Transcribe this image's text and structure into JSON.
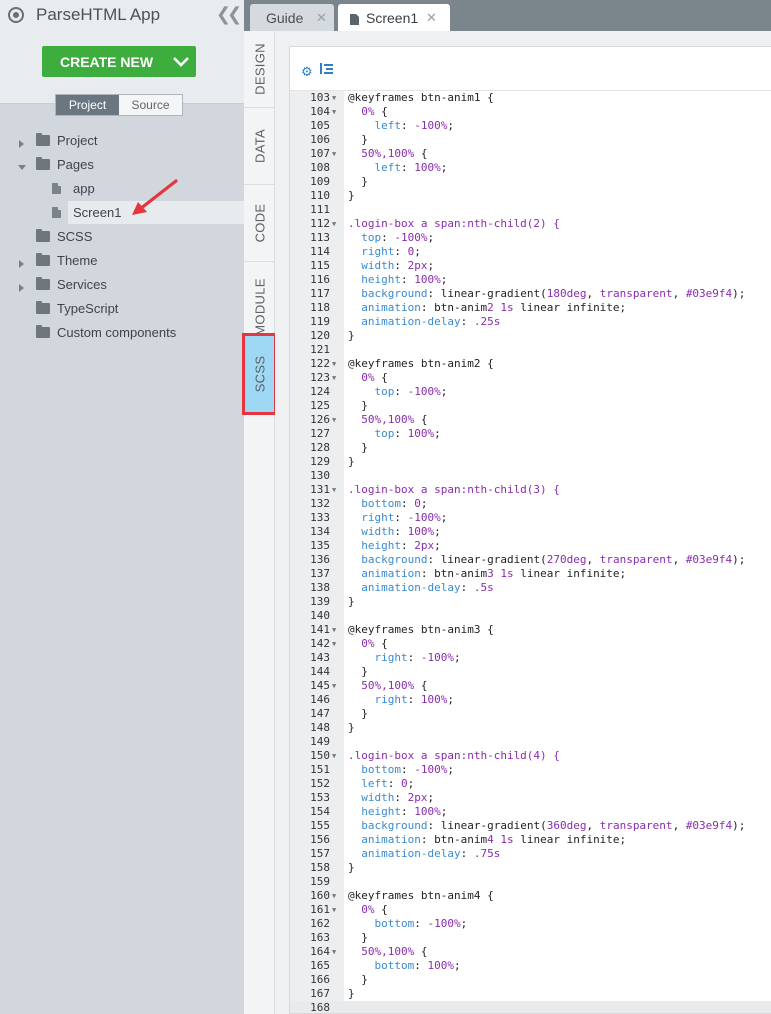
{
  "app": {
    "title": "ParseHTML App",
    "create_label": "CREATE NEW"
  },
  "toggle": {
    "project": "Project",
    "source": "Source"
  },
  "tree": [
    {
      "label": "Project",
      "type": "folder",
      "caret": "right"
    },
    {
      "label": "Pages",
      "type": "folder",
      "caret": "down"
    },
    {
      "label": "app",
      "type": "file"
    },
    {
      "label": "Screen1",
      "type": "file",
      "selected": true
    },
    {
      "label": "SCSS",
      "type": "folder"
    },
    {
      "label": "Theme",
      "type": "folder",
      "caret": "right"
    },
    {
      "label": "Services",
      "type": "folder",
      "caret": "right"
    },
    {
      "label": "TypeScript",
      "type": "folder"
    },
    {
      "label": "Custom components",
      "type": "folder"
    }
  ],
  "vtabs": [
    "DESIGN",
    "DATA",
    "CODE",
    "MODULE",
    "SCSS"
  ],
  "tabs": [
    {
      "label": "Guide"
    },
    {
      "label": "Screen1"
    }
  ],
  "colors": {
    "accent": "#3dae3d",
    "highlight": "#e5363f",
    "active_tab": "#9fd8f5"
  },
  "code_lines": [
    {
      "n": "103",
      "f": true,
      "t": "@keyframes btn-anim1 {"
    },
    {
      "n": "104",
      "f": true,
      "t": "  0% {"
    },
    {
      "n": "105",
      "f": false,
      "t": "    left: -100%;"
    },
    {
      "n": "106",
      "f": false,
      "t": "  }"
    },
    {
      "n": "107",
      "f": true,
      "t": "  50%,100% {"
    },
    {
      "n": "108",
      "f": false,
      "t": "    left: 100%;"
    },
    {
      "n": "109",
      "f": false,
      "t": "  }"
    },
    {
      "n": "110",
      "f": false,
      "t": "}"
    },
    {
      "n": "111",
      "f": false,
      "t": ""
    },
    {
      "n": "112",
      "f": true,
      "t": ".login-box a span:nth-child(2) {"
    },
    {
      "n": "113",
      "f": false,
      "t": "  top: -100%;"
    },
    {
      "n": "114",
      "f": false,
      "t": "  right: 0;"
    },
    {
      "n": "115",
      "f": false,
      "t": "  width: 2px;"
    },
    {
      "n": "116",
      "f": false,
      "t": "  height: 100%;"
    },
    {
      "n": "117",
      "f": false,
      "t": "  background: linear-gradient(180deg, transparent, #03e9f4);"
    },
    {
      "n": "118",
      "f": false,
      "t": "  animation: btn-anim2 1s linear infinite;"
    },
    {
      "n": "119",
      "f": false,
      "t": "  animation-delay: .25s"
    },
    {
      "n": "120",
      "f": false,
      "t": "}"
    },
    {
      "n": "121",
      "f": false,
      "t": ""
    },
    {
      "n": "122",
      "f": true,
      "t": "@keyframes btn-anim2 {"
    },
    {
      "n": "123",
      "f": true,
      "t": "  0% {"
    },
    {
      "n": "124",
      "f": false,
      "t": "    top: -100%;"
    },
    {
      "n": "125",
      "f": false,
      "t": "  }"
    },
    {
      "n": "126",
      "f": true,
      "t": "  50%,100% {"
    },
    {
      "n": "127",
      "f": false,
      "t": "    top: 100%;"
    },
    {
      "n": "128",
      "f": false,
      "t": "  }"
    },
    {
      "n": "129",
      "f": false,
      "t": "}"
    },
    {
      "n": "130",
      "f": false,
      "t": ""
    },
    {
      "n": "131",
      "f": true,
      "t": ".login-box a span:nth-child(3) {"
    },
    {
      "n": "132",
      "f": false,
      "t": "  bottom: 0;"
    },
    {
      "n": "133",
      "f": false,
      "t": "  right: -100%;"
    },
    {
      "n": "134",
      "f": false,
      "t": "  width: 100%;"
    },
    {
      "n": "135",
      "f": false,
      "t": "  height: 2px;"
    },
    {
      "n": "136",
      "f": false,
      "t": "  background: linear-gradient(270deg, transparent, #03e9f4);"
    },
    {
      "n": "137",
      "f": false,
      "t": "  animation: btn-anim3 1s linear infinite;"
    },
    {
      "n": "138",
      "f": false,
      "t": "  animation-delay: .5s"
    },
    {
      "n": "139",
      "f": false,
      "t": "}"
    },
    {
      "n": "140",
      "f": false,
      "t": ""
    },
    {
      "n": "141",
      "f": true,
      "t": "@keyframes btn-anim3 {"
    },
    {
      "n": "142",
      "f": true,
      "t": "  0% {"
    },
    {
      "n": "143",
      "f": false,
      "t": "    right: -100%;"
    },
    {
      "n": "144",
      "f": false,
      "t": "  }"
    },
    {
      "n": "145",
      "f": true,
      "t": "  50%,100% {"
    },
    {
      "n": "146",
      "f": false,
      "t": "    right: 100%;"
    },
    {
      "n": "147",
      "f": false,
      "t": "  }"
    },
    {
      "n": "148",
      "f": false,
      "t": "}"
    },
    {
      "n": "149",
      "f": false,
      "t": ""
    },
    {
      "n": "150",
      "f": true,
      "t": ".login-box a span:nth-child(4) {"
    },
    {
      "n": "151",
      "f": false,
      "t": "  bottom: -100%;"
    },
    {
      "n": "152",
      "f": false,
      "t": "  left: 0;"
    },
    {
      "n": "153",
      "f": false,
      "t": "  width: 2px;"
    },
    {
      "n": "154",
      "f": false,
      "t": "  height: 100%;"
    },
    {
      "n": "155",
      "f": false,
      "t": "  background: linear-gradient(360deg, transparent, #03e9f4);"
    },
    {
      "n": "156",
      "f": false,
      "t": "  animation: btn-anim4 1s linear infinite;"
    },
    {
      "n": "157",
      "f": false,
      "t": "  animation-delay: .75s"
    },
    {
      "n": "158",
      "f": false,
      "t": "}"
    },
    {
      "n": "159",
      "f": false,
      "t": ""
    },
    {
      "n": "160",
      "f": true,
      "t": "@keyframes btn-anim4 {"
    },
    {
      "n": "161",
      "f": true,
      "t": "  0% {"
    },
    {
      "n": "162",
      "f": false,
      "t": "    bottom: -100%;"
    },
    {
      "n": "163",
      "f": false,
      "t": "  }"
    },
    {
      "n": "164",
      "f": true,
      "t": "  50%,100% {"
    },
    {
      "n": "165",
      "f": false,
      "t": "    bottom: 100%;"
    },
    {
      "n": "166",
      "f": false,
      "t": "  }"
    },
    {
      "n": "167",
      "f": false,
      "t": "}"
    },
    {
      "n": "168",
      "f": false,
      "t": ""
    }
  ]
}
